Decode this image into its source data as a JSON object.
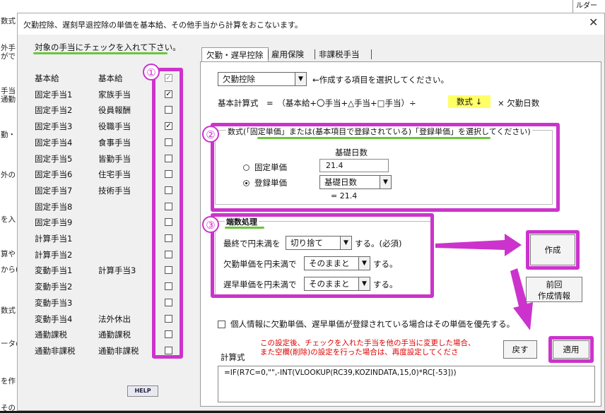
{
  "background": {
    "left_fragments": [
      "数式",
      "外手",
      "がで",
      "手当",
      "通勤",
      "勤・",
      "外の",
      "を入",
      "算や",
      "から(",
      "数式",
      "ータの",
      "を作",
      "その"
    ],
    "top_right": "ルダー"
  },
  "dialog": {
    "title": "欠勤控除、遅刻早退控除の単価を基本給、その他手当から計算をおこないます。",
    "close": "✕"
  },
  "left": {
    "heading": "対象の手当にチェックを入れて下さい。",
    "rows": [
      {
        "item": "基本給",
        "name": "基本給",
        "checked": true,
        "disabled": true
      },
      {
        "item": "固定手当1",
        "name": "家族手当",
        "checked": true,
        "disabled": false
      },
      {
        "item": "固定手当2",
        "name": "役員報酬",
        "checked": false,
        "disabled": false
      },
      {
        "item": "固定手当3",
        "name": "役職手当",
        "checked": true,
        "disabled": false
      },
      {
        "item": "固定手当4",
        "name": "食事手当",
        "checked": false,
        "disabled": false
      },
      {
        "item": "固定手当5",
        "name": "皆勤手当",
        "checked": false,
        "disabled": false
      },
      {
        "item": "固定手当6",
        "name": "住宅手当",
        "checked": false,
        "disabled": false
      },
      {
        "item": "固定手当7",
        "name": "技術手当",
        "checked": false,
        "disabled": false
      },
      {
        "item": "固定手当8",
        "name": "",
        "checked": false,
        "disabled": false
      },
      {
        "item": "固定手当9",
        "name": "",
        "checked": false,
        "disabled": false
      },
      {
        "item": "計算手当1",
        "name": "",
        "checked": false,
        "disabled": false
      },
      {
        "item": "計算手当2",
        "name": "",
        "checked": false,
        "disabled": false
      },
      {
        "item": "変動手当1",
        "name": "計算手当3",
        "checked": false,
        "disabled": false
      },
      {
        "item": "変動手当2",
        "name": "",
        "checked": false,
        "disabled": false
      },
      {
        "item": "変動手当3",
        "name": "",
        "checked": false,
        "disabled": false
      },
      {
        "item": "変動手当4",
        "name": "法外休出",
        "checked": false,
        "disabled": false
      },
      {
        "item": "通勤課税",
        "name": "通勤課税",
        "checked": false,
        "disabled": false
      },
      {
        "item": "通勤非課税",
        "name": "通勤非課税",
        "checked": false,
        "disabled": false
      }
    ],
    "help": "HELP"
  },
  "badges": [
    "①",
    "②",
    "③"
  ],
  "tabs": [
    "欠勤・遅早控除",
    "雇用保険",
    "非課税手当"
  ],
  "panel": {
    "item_select": "欠勤控除",
    "item_hint": "←作成する項目を選択してください。",
    "formula_label": "基本計算式　=　（基本給+〇手当+△手当+□手当）÷",
    "formula_highlight": "数式 ↓",
    "formula_tail": "× 欠勤日数",
    "group2_title": "数式(「固定単価」または(基本項目で登録されている)「登録単価」を選択してください)",
    "base_days_label": "基礎日数",
    "fixed_label": "固定単価",
    "fixed_value": "21.4",
    "registered_label": "登録単価",
    "registered_select": "基礎日数",
    "registered_result": "=  21.4",
    "group3_title": "端数処理",
    "round1_pre": "最終で円未満を",
    "round1_select": "切り捨て",
    "round1_post": "する。(必須)",
    "round2_pre": "欠勤単価を円未満で",
    "round2_select": "そのままと",
    "round2_post": "する。",
    "round3_pre": "遅早単価を円未満で",
    "round3_select": "そのままと",
    "round3_post": "する。",
    "create_button": "作成",
    "prev_button": "前回\n作成情報",
    "priority_label": "個人情報に欠勤単価、遅早単価が登録されている場合はその単価を優先する。",
    "formula_caption": "計算式",
    "warning": "この設定後、チェックを入れた手当を他の手当に変更した場合、\nまた空欄(削除)の設定を行った場合は、再度設定してくださ",
    "back_button": "戻す",
    "apply_button": "適用",
    "formula_value": "=IF(R7C=0,\"\",-INT(VLOOKUP(RC39,KOZINDATA,15,0)*RC[-53]))"
  },
  "colors": {
    "annotation": "#cc33cc",
    "underline": "#6ac73a",
    "highlight": "#ffff66",
    "warning": "#e00000"
  }
}
